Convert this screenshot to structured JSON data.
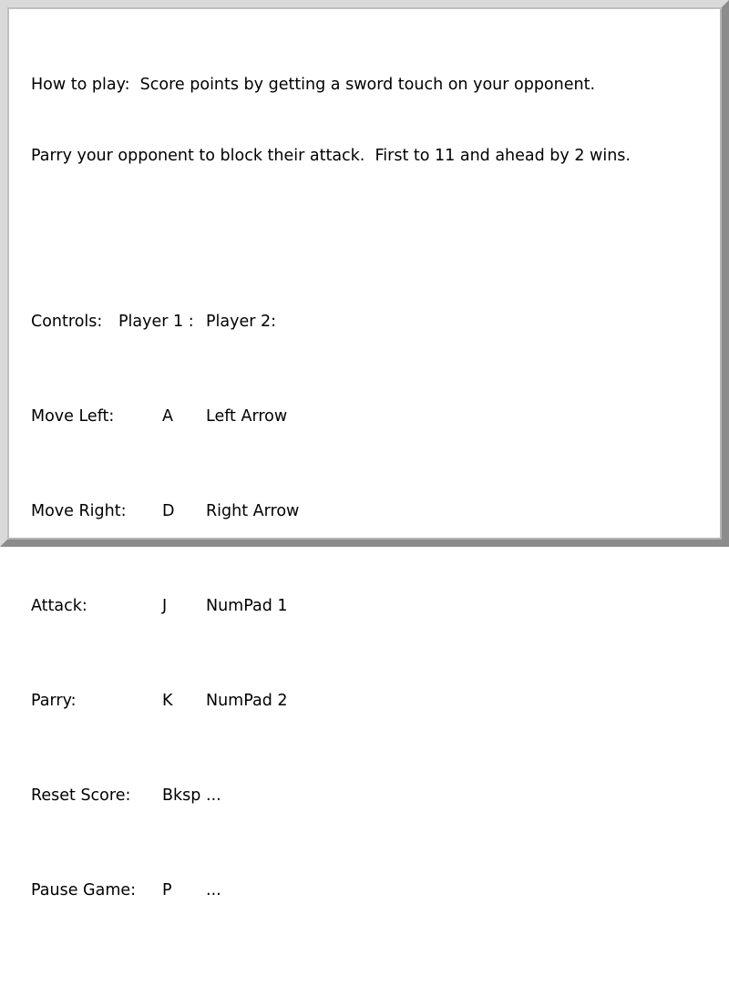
{
  "instructions": {
    "line1": "How to play:  Score points by getting a sword touch on your opponent.",
    "line2": "Parry your opponent to block their attack.  First to 11 and ahead by 2 wins."
  },
  "controls": {
    "header": {
      "label": "Controls:",
      "player1": "Player 1 :",
      "player2": "Player 2:"
    },
    "rows": [
      {
        "action": "Move Left:",
        "p1": "A",
        "p2": "Left Arrow"
      },
      {
        "action": "Move Right:",
        "p1": "D",
        "p2": "Right Arrow"
      },
      {
        "action": "Attack:",
        "p1": "J",
        "p2": "NumPad 1"
      },
      {
        "action": "Parry:",
        "p1": "K",
        "p2": "NumPad 2"
      },
      {
        "action": "Reset Score:",
        "p1": "Bksp",
        "p2": "..."
      },
      {
        "action": "Pause Game:",
        "p1": "P",
        "p2": "..."
      }
    ]
  }
}
